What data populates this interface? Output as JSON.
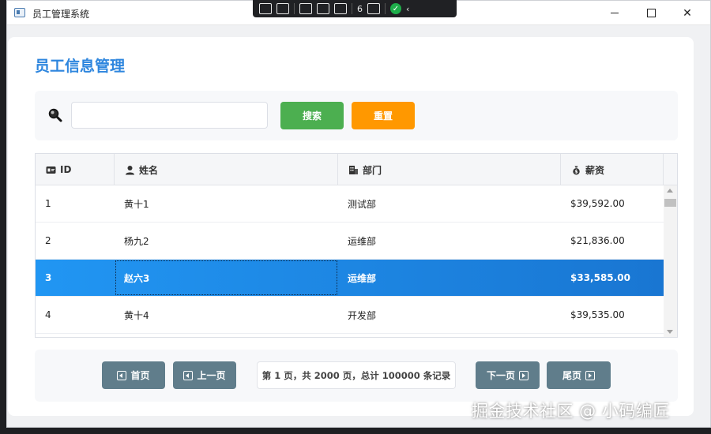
{
  "window": {
    "title": "员工管理系统"
  },
  "devbar": {
    "badge_count": "6"
  },
  "header": {
    "title": "员工信息管理"
  },
  "search": {
    "placeholder": "",
    "value": "",
    "search_label": "搜索",
    "reset_label": "重置",
    "search_color": "#4caf50",
    "reset_color": "#ff9800"
  },
  "table": {
    "columns": [
      {
        "label": "ID",
        "icon": "id-card-icon"
      },
      {
        "label": "姓名",
        "icon": "user-icon"
      },
      {
        "label": "部门",
        "icon": "building-icon"
      },
      {
        "label": "薪资",
        "icon": "money-bag-icon"
      }
    ],
    "rows": [
      {
        "id": "1",
        "name": "黄十1",
        "dept": "测试部",
        "salary": "$39,592.00"
      },
      {
        "id": "2",
        "name": "杨九2",
        "dept": "运维部",
        "salary": "$21,836.00"
      },
      {
        "id": "3",
        "name": "赵六3",
        "dept": "运维部",
        "salary": "$33,585.00"
      },
      {
        "id": "4",
        "name": "黄十4",
        "dept": "开发部",
        "salary": "$39,535.00"
      }
    ],
    "selected_row": 2,
    "selected_color": "#1e88e5"
  },
  "pagination": {
    "first_label": "首页",
    "prev_label": "上一页",
    "next_label": "下一页",
    "last_label": "尾页",
    "info": "第 1 页，共 2000 页，总计 100000 条记录",
    "button_color": "#607d8b"
  },
  "watermark": "掘金技术社区 @ 小码编匠"
}
